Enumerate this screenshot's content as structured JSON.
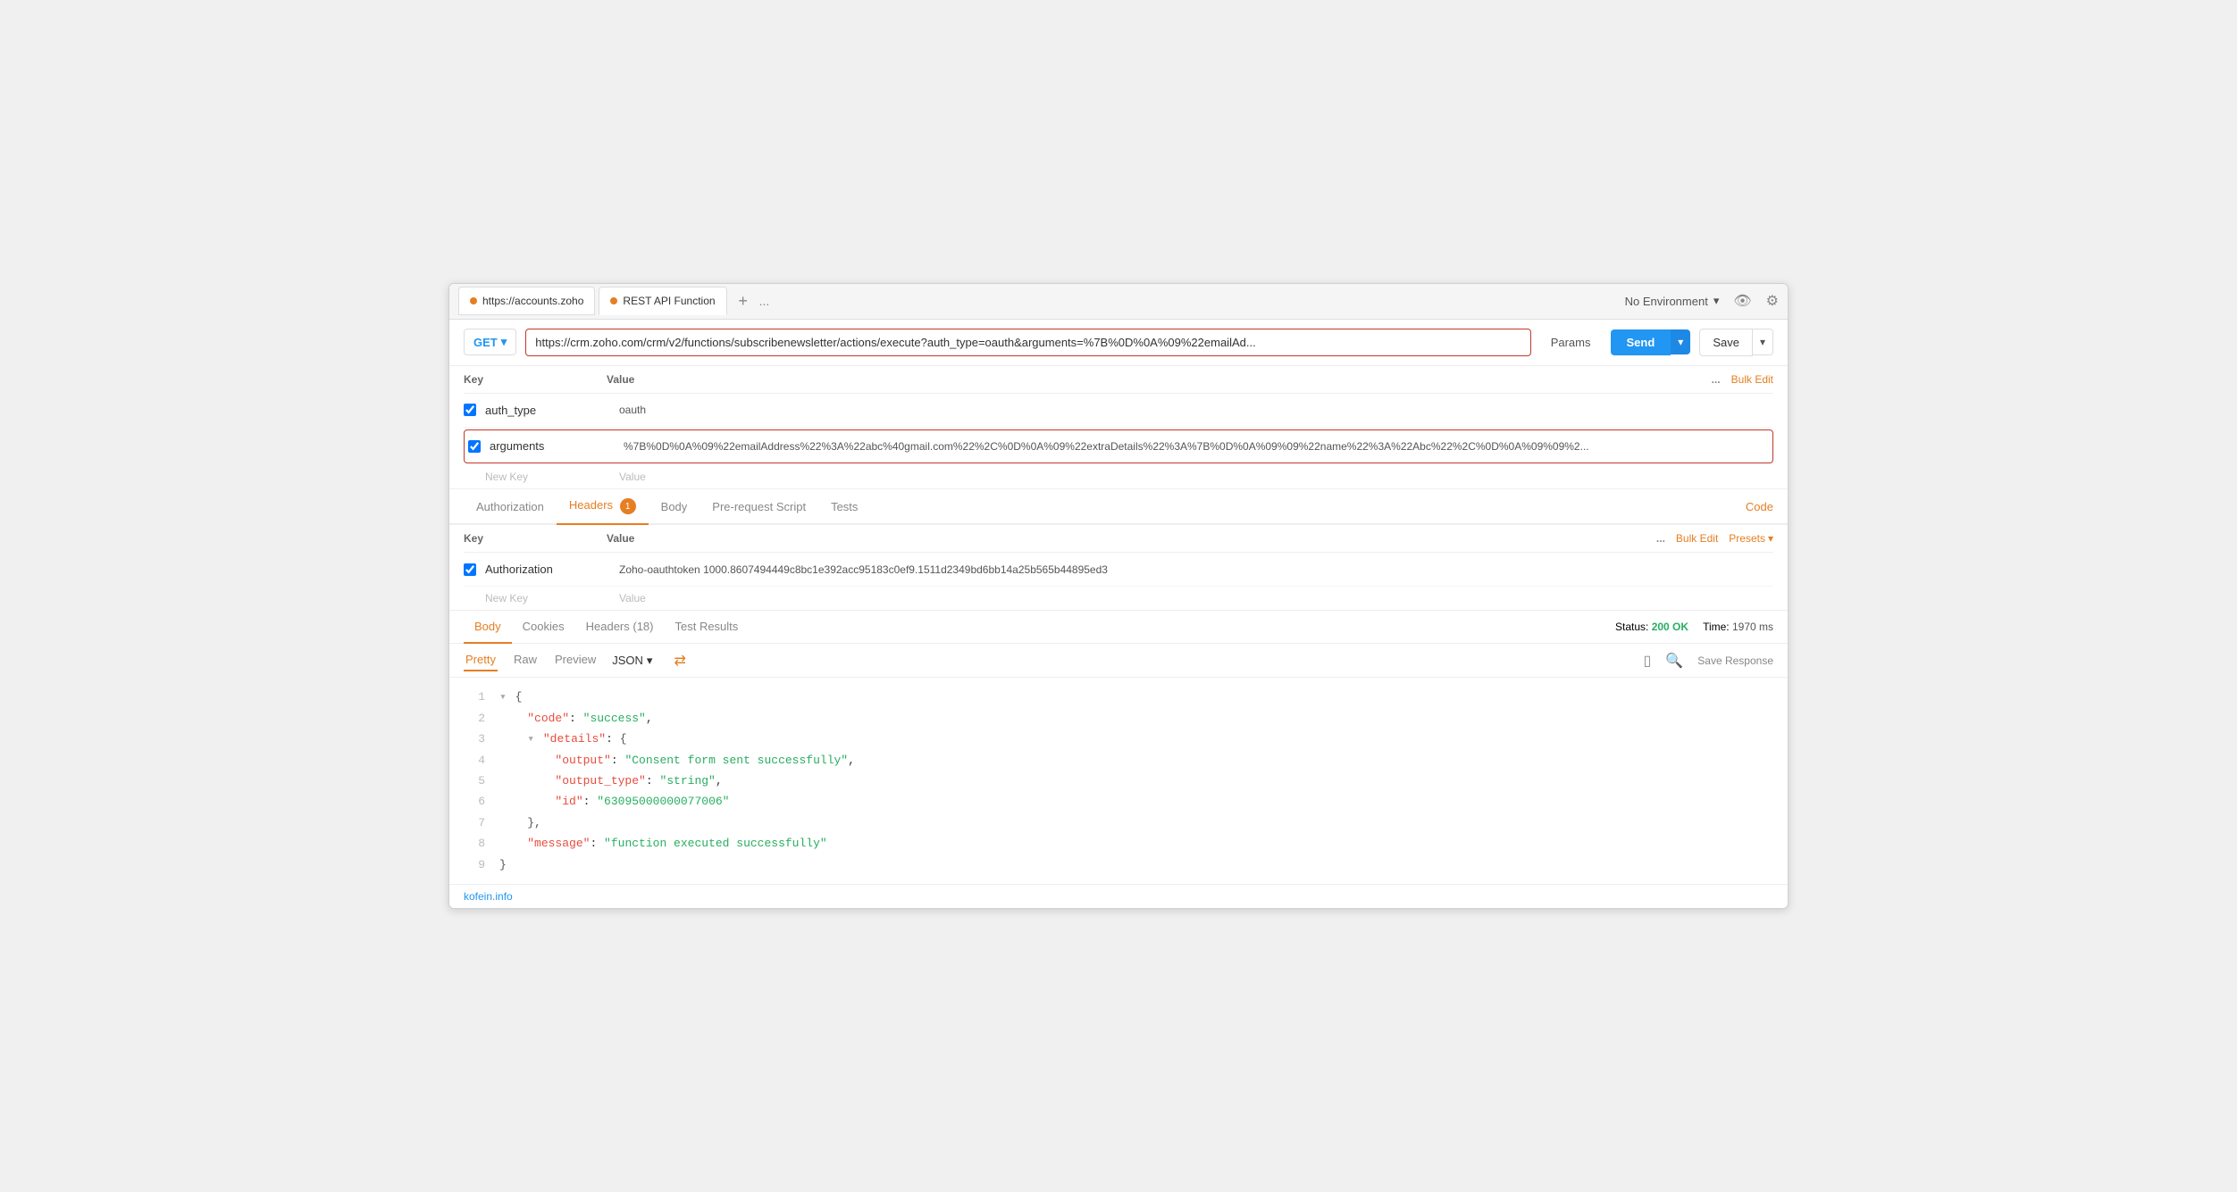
{
  "tabs": [
    {
      "label": "https://accounts.zoho",
      "dot": true,
      "active": false
    },
    {
      "label": "REST API Function",
      "dot": true,
      "active": true
    }
  ],
  "tab_add_label": "+",
  "tab_more_label": "...",
  "env": {
    "label": "No Environment",
    "chevron": "▾"
  },
  "request": {
    "method": "GET",
    "url": "https://crm.zoho.com/crm/v2/functions/subscribenewsletter/actions/execute?auth_type=oauth&arguments=%7B%0D%0A%09%22emailAd...",
    "params_label": "Params",
    "send_label": "Send",
    "save_label": "Save"
  },
  "params_table": {
    "key_header": "Key",
    "value_header": "Value",
    "more_label": "...",
    "bulk_edit_label": "Bulk Edit",
    "rows": [
      {
        "checked": true,
        "key": "auth_type",
        "value": "oauth",
        "highlighted": false
      },
      {
        "checked": true,
        "key": "arguments",
        "value": "%7B%0D%0A%09%22emailAddress%22%3A%22abc%40gmail.com%22%2C%0D%0A%09%22extraDetails%22%3A%7B%0D%0A%09%09%22name%22%3A%22Abc%22%2C%0D%0A%09%09%2...",
        "highlighted": true
      }
    ],
    "new_key_placeholder": "New Key",
    "new_value_placeholder": "Value"
  },
  "request_tabs": [
    {
      "label": "Authorization",
      "active": false,
      "badge": null
    },
    {
      "label": "Headers",
      "active": true,
      "badge": "1"
    },
    {
      "label": "Body",
      "active": false,
      "badge": null
    },
    {
      "label": "Pre-request Script",
      "active": false,
      "badge": null
    },
    {
      "label": "Tests",
      "active": false,
      "badge": null
    }
  ],
  "code_label": "Code",
  "headers_table": {
    "key_header": "Key",
    "value_header": "Value",
    "more_label": "...",
    "bulk_edit_label": "Bulk Edit",
    "presets_label": "Presets",
    "rows": [
      {
        "checked": true,
        "key": "Authorization",
        "value": "Zoho-oauthtoken 1000.8607494449c8bc1e392acc95183c0ef9.1511d2349bd6bb14a25b565b44895ed3"
      }
    ],
    "new_key_placeholder": "New Key",
    "new_value_placeholder": "Value"
  },
  "response": {
    "tabs": [
      {
        "label": "Body",
        "active": true
      },
      {
        "label": "Cookies",
        "active": false
      },
      {
        "label": "Headers (18)",
        "active": false
      },
      {
        "label": "Test Results",
        "active": false
      }
    ],
    "status_label": "Status:",
    "status_value": "200 OK",
    "time_label": "Time:",
    "time_value": "1970 ms"
  },
  "format_bar": {
    "tabs": [
      {
        "label": "Pretty",
        "active": true
      },
      {
        "label": "Raw",
        "active": false
      },
      {
        "label": "Preview",
        "active": false
      }
    ],
    "format_select": "JSON",
    "save_response_label": "Save Response"
  },
  "json_content": {
    "lines": [
      {
        "num": "1",
        "content": "{",
        "type": "brace_open"
      },
      {
        "num": "2",
        "content": "\"code\": \"success\",",
        "type": "key_string"
      },
      {
        "num": "3",
        "content": "\"details\": {",
        "type": "key_brace"
      },
      {
        "num": "4",
        "content": "    \"output\": \"Consent form sent successfully\",",
        "type": "key_string"
      },
      {
        "num": "5",
        "content": "    \"output_type\": \"string\",",
        "type": "key_string"
      },
      {
        "num": "6",
        "content": "    \"id\": \"63095000000077006\"",
        "type": "key_string"
      },
      {
        "num": "7",
        "content": "},",
        "type": "brace_close"
      },
      {
        "num": "8",
        "content": "\"message\": \"function executed successfully\"",
        "type": "key_string"
      },
      {
        "num": "9",
        "content": "}",
        "type": "brace_close"
      }
    ]
  },
  "footer": {
    "link_label": "kofein.info"
  }
}
